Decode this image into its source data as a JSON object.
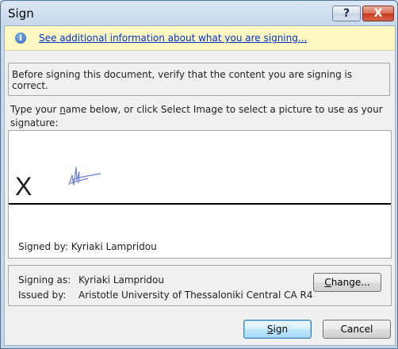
{
  "window": {
    "title": "Sign",
    "help_label": "?",
    "close_label": "X"
  },
  "infobar": {
    "icon": "info-icon",
    "icon_glyph": "i",
    "link_text": "See additional information about what you are signing..."
  },
  "instructions": "Before signing this document, verify that the content you are signing is correct.",
  "prompt": {
    "before": "Type your ",
    "underlined": "n",
    "after": "ame below, or click Select Image to select a picture to use as your signature:"
  },
  "signature": {
    "x_mark": "X",
    "signed_by": "Signed by: Kyriaki Lampridou"
  },
  "signer": {
    "signing_as_label": "Signing as:",
    "signing_as_value": "Kyriaki Lampridou",
    "issued_by_label": "Issued by:",
    "issued_by_value": "Aristotle University of Thessaloniki Central CA R4"
  },
  "buttons": {
    "change_u": "C",
    "change_rest": "hange...",
    "sign_u": "S",
    "sign_rest": "ign",
    "cancel": "Cancel"
  },
  "colors": {
    "link": "#0033cc",
    "infobar_bg": "#fdf7c2",
    "signature_ink": "#6a7fd0"
  }
}
